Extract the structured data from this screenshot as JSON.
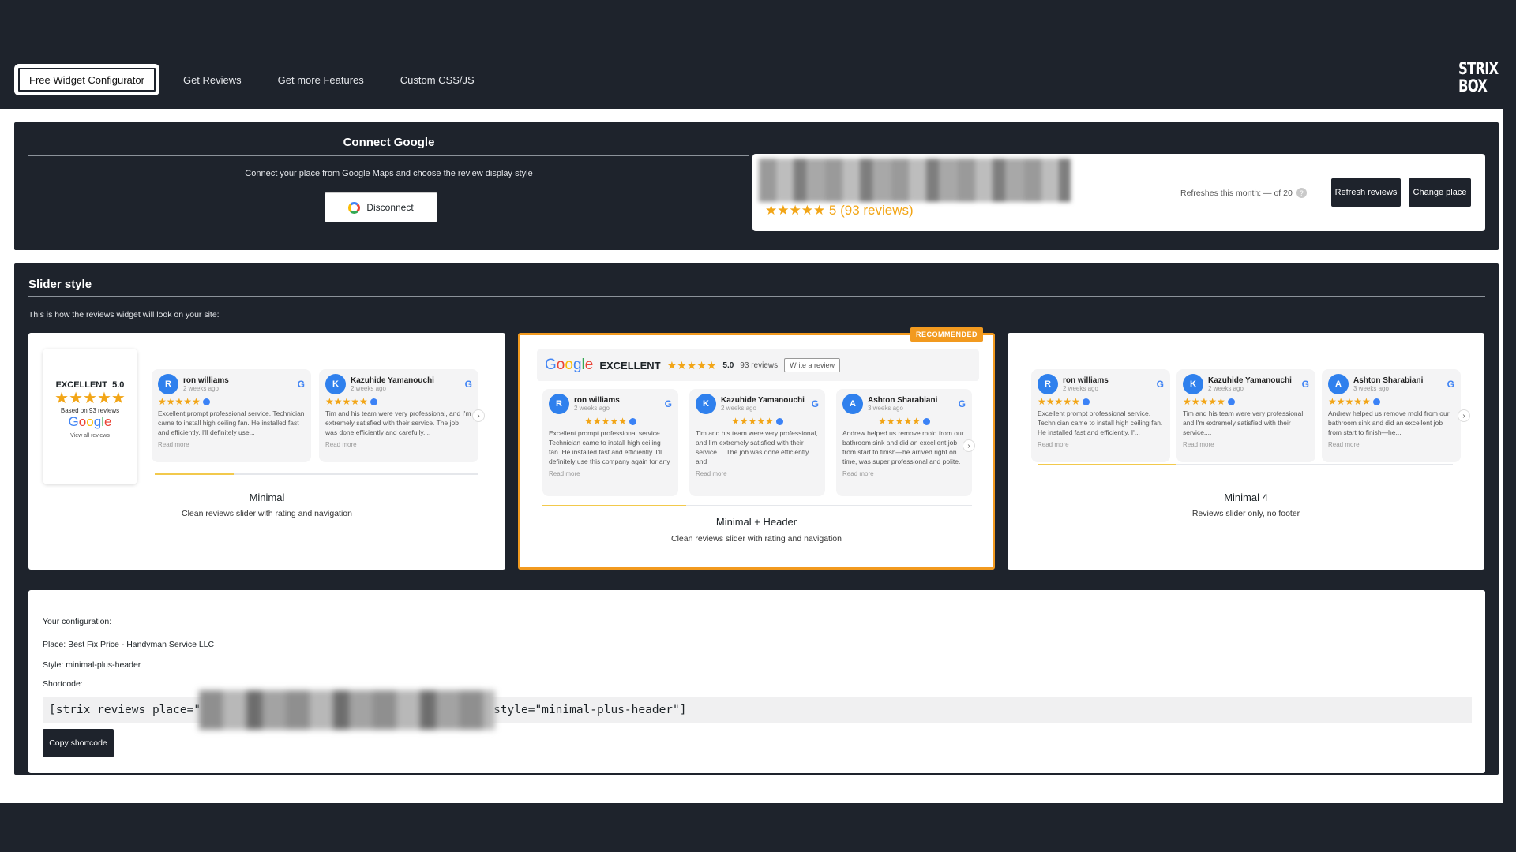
{
  "nav": {
    "tabs": [
      {
        "label": "Free Widget Configurator",
        "active": true
      },
      {
        "label": "Get Reviews"
      },
      {
        "label": "Get more Features"
      },
      {
        "label": "Custom CSS/JS"
      }
    ],
    "logo_line1": "STRIX",
    "logo_line2": "BOX"
  },
  "connect": {
    "title": "Connect Google",
    "subtitle": "Connect your place from Google Maps and choose the review display style",
    "disconnect_label": "Disconnect",
    "place_rating": "★★★★★ 5 (93 reviews)",
    "refreshes_text": "Refreshes this month: — of 20",
    "refresh_help": "?",
    "refresh_label": "Refresh reviews",
    "change_label": "Change place"
  },
  "slider": {
    "title": "Slider style",
    "subtitle": "This is how the reviews widget will look on your site:",
    "styles": [
      {
        "name": "Minimal",
        "desc": "Clean reviews slider with rating and navigation"
      },
      {
        "name": "Minimal + Header",
        "desc": "Clean reviews slider with rating and navigation",
        "badge": "RECOMMENDED"
      },
      {
        "name": "Minimal 4",
        "desc": "Reviews slider only, no footer"
      }
    ],
    "summary": {
      "rating_label": "EXCELLENT",
      "rating_value": "5.0",
      "stars": "★★★★★",
      "based_on": "Based on 93 reviews",
      "google": "Google",
      "view_all": "View all reviews"
    },
    "header": {
      "google": "Google",
      "rating_label": "EXCELLENT",
      "stars": "★★★★★",
      "score": "5.0",
      "count": "93 reviews",
      "write_label": "Write a review"
    },
    "reviews": [
      {
        "initial": "R",
        "name": "ron williams",
        "time": "2 weeks ago",
        "stars": "★★★★★",
        "text": "Excellent prompt professional service. Technician came to install high ceiling fan. He installed fast and efficiently. I'll definitely use...",
        "more": "Read more"
      },
      {
        "initial": "K",
        "name": "Kazuhide Yamanouchi",
        "time": "2 weeks ago",
        "stars": "★★★★★",
        "text": "Tim and his team were very professional, and I'm extremely satisfied with their service. The job was done efficiently and carefully....",
        "more": "Read more"
      },
      {
        "initial": "A",
        "name": "Ashton Sharabiani",
        "time": "3 weeks ago",
        "stars": "★★★★★",
        "text": "Andrew helped us remove mold from our bathroom sink and did an excellent job from start to finish—he arrived right on... time, was super professional and polite.",
        "more": "Read more"
      }
    ],
    "reviews_hdr": [
      {
        "text": "Excellent prompt professional service. Technician came to install high ceiling fan. He installed fast and efficiently. I'll definitely use this company again for any"
      },
      {
        "text": "Tim and his team were very professional, and I'm extremely satisfied with their service.... The job was done efficiently and"
      },
      {
        "text": "Andrew helped us remove mold from our bathroom sink and did an excellent job from start to finish—he arrived right on... time, was super professional and polite."
      }
    ],
    "reviews_m4": [
      {
        "text": "Excellent prompt professional service. Technician came to install high ceiling fan. He installed fast and efficiently. I'..."
      },
      {
        "text": "Tim and his team were very professional, and I'm extremely satisfied with their service...."
      },
      {
        "text": "Andrew helped us remove mold from our bathroom sink and did an excellent job from start to finish—he..."
      }
    ],
    "arrow": "›"
  },
  "config": {
    "heading": "Your configuration:",
    "place_label": "Place:",
    "place_value": "Best Fix Price - Handyman Service LLC",
    "style_label": "Style:",
    "style_value": "minimal-plus-header",
    "shortcode_label": "Shortcode:",
    "shortcode_prefix": "[strix_reviews place=\"",
    "shortcode_suffix": "style=\"minimal-plus-header\"]",
    "copy_label": "Copy shortcode"
  },
  "colors": {
    "accent": "#f29a1f",
    "dark": "#1e232c",
    "star": "#f2a516"
  }
}
